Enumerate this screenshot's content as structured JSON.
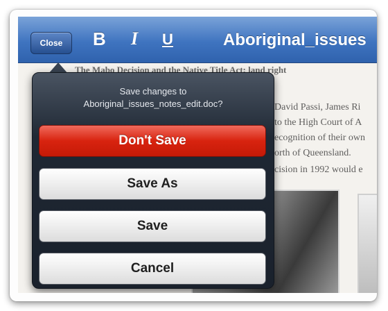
{
  "toolbar": {
    "close_label": "Close",
    "bold_label": "B",
    "italic_label": "I",
    "underline_label": "U",
    "document_title": "Aboriginal_issues"
  },
  "document": {
    "heading": "The Mabo Decision and the Native Title Act: land right",
    "lines": [
      "David Passi, James Ri",
      "to the High Court of A",
      "ecognition of their own",
      "orth of Queensland.",
      "cision in 1992 would e"
    ]
  },
  "dialog": {
    "prompt_line1": "Save changes to",
    "prompt_line2": "Aboriginal_issues_notes_edit.doc?",
    "dont_save_label": "Don't Save",
    "save_as_label": "Save As",
    "save_label": "Save",
    "cancel_label": "Cancel"
  },
  "colors": {
    "toolbar_blue": "#3f74c0",
    "destructive_red": "#d8230f",
    "popover_dark": "#1f2834"
  }
}
